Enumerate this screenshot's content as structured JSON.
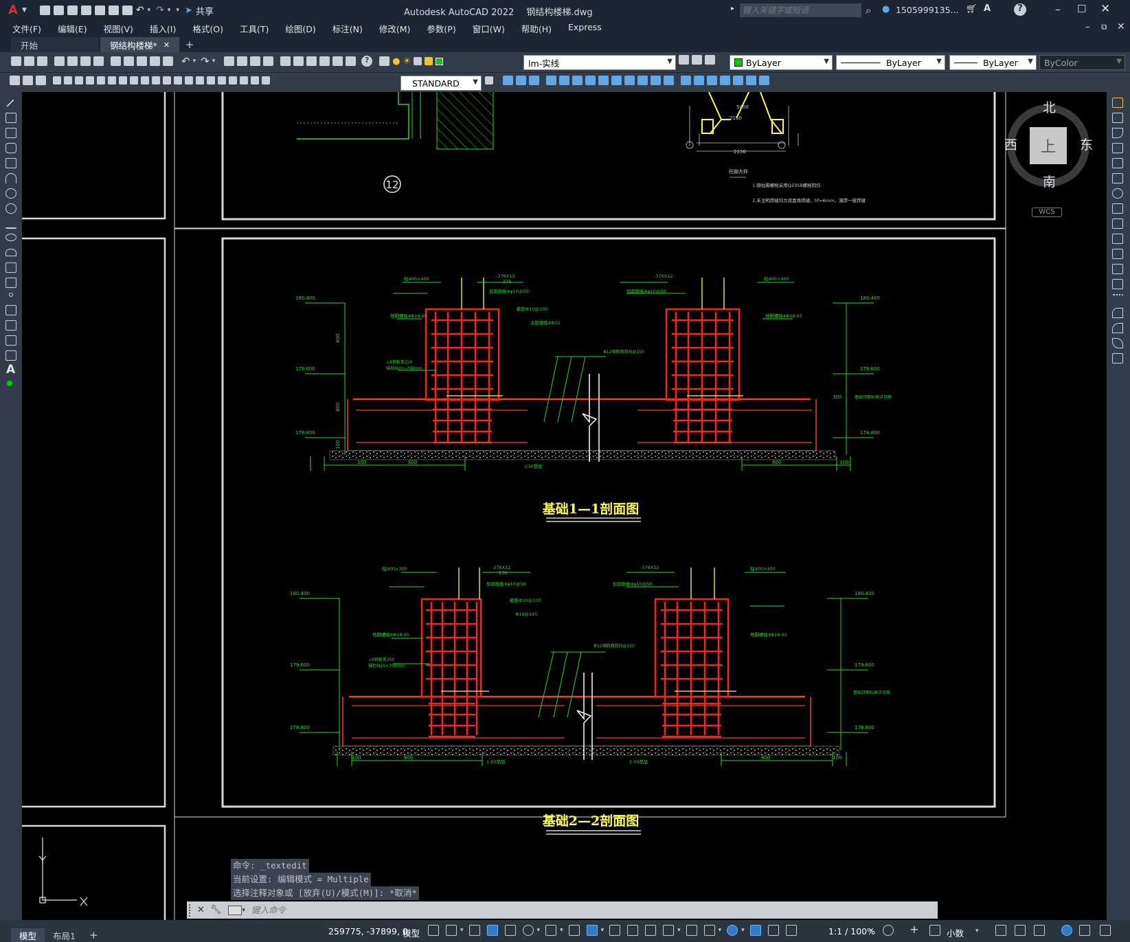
{
  "window": {
    "app_title": "Autodesk AutoCAD 2022",
    "doc_title": "钢结构楼梯.dwg",
    "share_label": "共享",
    "search_placeholder": "键入关键字或短语",
    "user": "1505999135..."
  },
  "menu": [
    "文件(F)",
    "编辑(E)",
    "视图(V)",
    "插入(I)",
    "格式(O)",
    "工具(T)",
    "绘图(D)",
    "标注(N)",
    "修改(M)",
    "参数(P)",
    "窗口(W)",
    "帮助(H)",
    "Express"
  ],
  "tabs": [
    {
      "label": "开始"
    },
    {
      "label": "钢结构楼梯*"
    }
  ],
  "layer": {
    "current": "lm-实线"
  },
  "properties": {
    "color": "ByLayer",
    "linetype": "ByLayer",
    "lineweight": "ByLayer",
    "plotstyle": "ByColor",
    "textstyle": "STANDARD"
  },
  "viewcube": {
    "north": "北",
    "south": "南",
    "east": "东",
    "west": "西",
    "top": "上",
    "wcs": "WCS"
  },
  "drawing": {
    "title1": "基础1—1剖面图",
    "title2": "基础2—2剖面图",
    "label_12": "12",
    "top_note_title": "柱脚大样",
    "top_notes": [
      "1.钢柱脚螺栓采用Q235B螺栓制作",
      "2.未注明焊缝均为双面角焊缝，hf=6mm，满焊一级焊缝"
    ],
    "dims_top": [
      "2150",
      "5400",
      "2150",
      "2150"
    ],
    "sec1_elev": [
      "180.400",
      "179.600",
      "178.800"
    ],
    "sec2_elev": [
      "180.400",
      "179.600",
      "178.800"
    ],
    "sec1_left_labels": [
      "柱400×400",
      "地脚螺栓4Φ16-65",
      "↓8钢板宽250",
      "锚栓M20×700mm"
    ],
    "sec1_mid_labels": [
      "-376X12",
      "376",
      "加劲肋板4φ10@50",
      "箍筋Φ10@100",
      "主筋钢筋4Φ22"
    ],
    "sec1_right_labels": [
      "柱400×400",
      "-376X12",
      "加劲肋板4φ10@50",
      "地脚螺栓4Φ16-65"
    ],
    "sec1_center_label": "Φ12钢筋网双向@150",
    "sec1_dims_bottom": [
      "100",
      "800",
      "C30垫层",
      "800",
      "100"
    ],
    "sec1_heights": [
      "800",
      "800",
      "100",
      "300"
    ],
    "sec2_left_labels": [
      "柱300×300",
      "地脚螺栓4Φ16-65",
      "↓8钢板宽250",
      "锚栓M20×700mm"
    ],
    "sec2_mid_labels": [
      "-276X12",
      "276",
      "加劲肋板4φ10@50",
      "箍筋Φ10@100",
      "Φ16@165"
    ],
    "sec2_right_labels": [
      "柱400×400",
      "-376X12",
      "加劲肋板4φ10@50",
      "地脚螺栓4Φ16-65"
    ],
    "sec2_center_label": "Φ12钢筋网双向@150",
    "sec2_dims_bottom": [
      "100",
      "800",
      "1:50垫层",
      "2.00垫层",
      "800",
      "100"
    ],
    "right_note": "基础顶面标高详见图"
  },
  "command": {
    "history": [
      "命令: _textedit",
      "当前设置: 编辑模式 = Multiple",
      "选择注释对象或 [放弃(U)/模式(M)]: *取消*"
    ],
    "placeholder": "键入命令"
  },
  "layouts": [
    {
      "label": "模型"
    },
    {
      "label": "布局1"
    }
  ],
  "status": {
    "coords": "259775, -37899, 0",
    "mode": "模型",
    "scale": "1:1 / 100%",
    "units": "小数"
  },
  "colors": {
    "frame": "#1b2632",
    "toolbar": "#323d49",
    "rebar": "#ff2020",
    "dim": "#22dd22",
    "beam": "#e86a24",
    "title": "#ffff44"
  }
}
